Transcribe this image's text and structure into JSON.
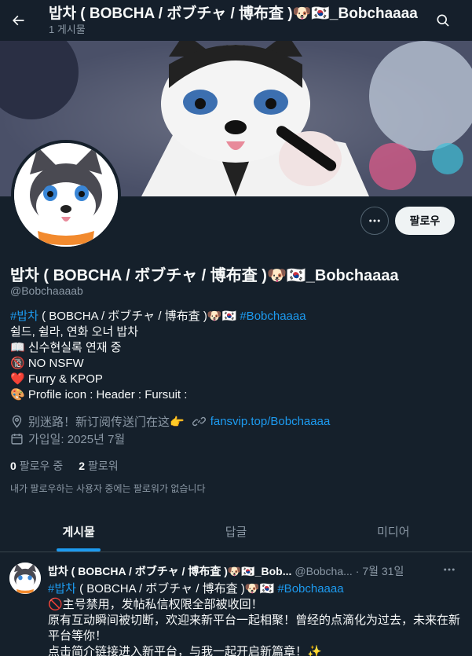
{
  "header": {
    "title": "밥차 ( BOBCHA / ボブチャ / 博布査 )🐶🇰🇷_Bobchaaaa",
    "post_count": "1 게시물"
  },
  "profile": {
    "display_name": "밥차 ( BOBCHA / ボブチャ / 博布査 )🐶🇰🇷_Bobchaaaa",
    "handle": "@Bobchaaaab",
    "follow_label": "팔로우",
    "bio": {
      "line1_tag": "#밥차",
      "line1_text": " ( BOBCHA / ボブチャ / 博布査 )🐶🇰🇷 ",
      "line1_tag2": "#Bobchaaaa",
      "line2": "쉴드, 쉴라, 연화 오너 밥차",
      "line3": "📖 신수현실록 연재 중",
      "line4": "🔞 NO NSFW",
      "line5": "❤️ Furry & KPOP",
      "line6": "🎨 Profile icon : Header : Fursuit :"
    },
    "location": "别迷路！新订阅传送门在这👉",
    "website": "fansvip.top/Bobchaaaa",
    "joined": "가입일: 2025년 7월",
    "following_count": "0",
    "following_label": "팔로우 중",
    "followers_count": "2",
    "followers_label": "팔로워",
    "mutual_note": "내가 팔로우하는 사용자 중에는 팔로워가 없습니다"
  },
  "tabs": [
    "게시물",
    "답글",
    "미디어"
  ],
  "post": {
    "name": "밥차 ( BOBCHA / ボブチャ / 博布査 )🐶🇰🇷_Bob...",
    "handle": "@Bobcha...",
    "date": "· 7월 31일",
    "tag1": "#밥차",
    "line1_text": " ( BOBCHA / ボブチャ / 博布査 )🐶🇰🇷 ",
    "tag2": "#Bobchaaaa",
    "line2": "🚫主号禁用，发帖私信权限全部被收回！",
    "line3": "原有互动瞬间被切断，欢迎来新平台一起相聚！曾经的点滴化为过去，未来在新平台等你！",
    "line4": "点击简介链接进入新平台，与我一起开启新篇章！✨"
  },
  "colors": {
    "accent": "#1d9bf0",
    "background": "#15202b",
    "muted": "#8b98a5"
  }
}
